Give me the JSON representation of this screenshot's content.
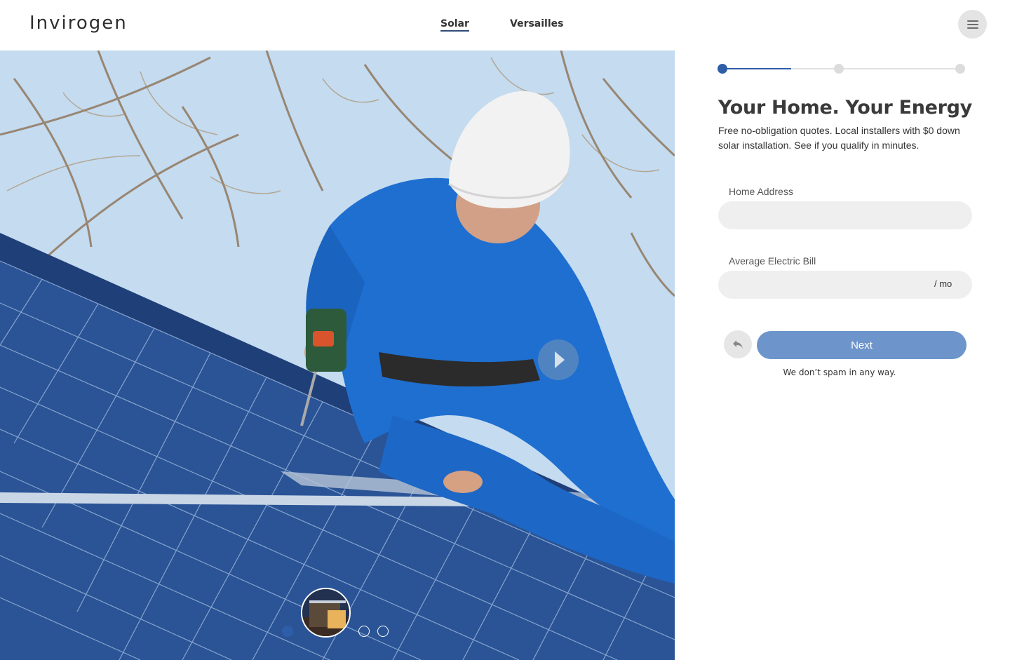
{
  "header": {
    "logo": "Invirogen",
    "nav": [
      {
        "label": "Solar",
        "active": true
      },
      {
        "label": "Versailles",
        "active": false
      }
    ],
    "menu_icon": "hamburger-icon"
  },
  "hero": {
    "play_icon": "play-icon",
    "carousel": {
      "slide_count": 4,
      "active_index": 0
    }
  },
  "form": {
    "progress": {
      "steps": 3,
      "current_step": 1,
      "fill_fraction": 0.3
    },
    "title": "Your Home. Your Energy",
    "subtitle": "Free no-obligation quotes. Local installers with $0 down solar installation. See if you qualify in minutes.",
    "fields": {
      "address": {
        "label": "Home Address",
        "value": "",
        "placeholder": ""
      },
      "bill": {
        "label": "Average Electric Bill",
        "value": "",
        "placeholder": "",
        "suffix": "/ mo"
      }
    },
    "back_icon": "reply-arrow-icon",
    "next_label": "Next",
    "disclaimer": "We don’t spam in any way."
  },
  "colors": {
    "accent": "#2f5ea8",
    "button": "#6d95cb",
    "input_bg": "#efefef"
  }
}
